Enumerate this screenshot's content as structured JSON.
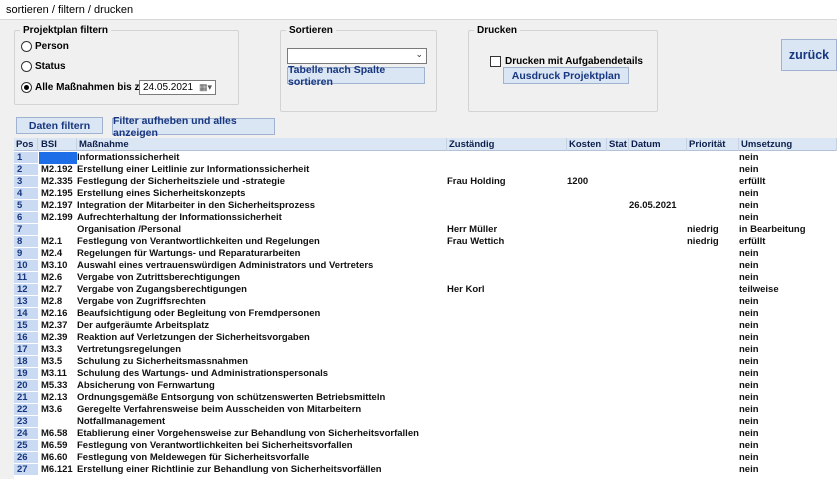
{
  "window": {
    "title": "sortieren / filtern / drucken"
  },
  "filter_group": {
    "legend": "Projektplan filtern",
    "options": [
      {
        "label": "Person",
        "selected": false
      },
      {
        "label": "Status",
        "selected": false
      },
      {
        "label": "Alle Maßnahmen bis zum",
        "selected": true
      }
    ],
    "date_value": "24.05.2021"
  },
  "sort_group": {
    "legend": "Sortieren",
    "combo_value": "",
    "sort_button": "Tabelle nach Spalte sortieren"
  },
  "print_group": {
    "legend": "Drucken",
    "checkbox_label": "Drucken mit Aufgabendetails",
    "checkbox_checked": false,
    "print_button": "Ausdruck Projektplan"
  },
  "back_button": "zurück",
  "filter_button": "Daten filtern",
  "reset_button": "Filter aufheben und alles anzeigen",
  "table": {
    "columns": {
      "pos": "Pos",
      "bsi": "BSI",
      "massnahme": "Maßnahme",
      "zustaendig": "Zuständig",
      "kosten": "Kosten",
      "stat": "Stat",
      "datum": "Datum",
      "prioritaet": "Priorität",
      "umsetzung": "Umsetzung"
    },
    "rows": [
      {
        "pos": "1",
        "bsi": "",
        "massnahme": "Informationssicherheit",
        "zustaendig": "",
        "kosten": "",
        "stat": "",
        "datum": "",
        "prioritaet": "",
        "umsetzung": "nein"
      },
      {
        "pos": "2",
        "bsi": "M2.192",
        "massnahme": "Erstellung einer Leitlinie zur Informationssicherheit",
        "zustaendig": "",
        "kosten": "",
        "stat": "",
        "datum": "",
        "prioritaet": "",
        "umsetzung": "nein"
      },
      {
        "pos": "3",
        "bsi": "M2.335",
        "massnahme": "Festlegung der Sicherheitsziele und -strategie",
        "zustaendig": "Frau Holding",
        "kosten": "1200",
        "stat": "",
        "datum": "",
        "prioritaet": "",
        "umsetzung": "erfüllt"
      },
      {
        "pos": "4",
        "bsi": "M2.195",
        "massnahme": "Erstellung eines Sicherheitskonzepts",
        "zustaendig": "",
        "kosten": "",
        "stat": "",
        "datum": "",
        "prioritaet": "",
        "umsetzung": "nein"
      },
      {
        "pos": "5",
        "bsi": "M2.197",
        "massnahme": "Integration der Mitarbeiter in den Sicherheitsprozess",
        "zustaendig": "",
        "kosten": "",
        "stat": "",
        "datum": "26.05.2021",
        "prioritaet": "",
        "umsetzung": "nein"
      },
      {
        "pos": "6",
        "bsi": "M2.199",
        "massnahme": "Aufrechterhaltung der Informationssicherheit",
        "zustaendig": "",
        "kosten": "",
        "stat": "",
        "datum": "",
        "prioritaet": "",
        "umsetzung": "nein"
      },
      {
        "pos": "7",
        "bsi": "",
        "massnahme": "Organisation /Personal",
        "zustaendig": "Herr Müller",
        "kosten": "",
        "stat": "",
        "datum": "",
        "prioritaet": "niedrig",
        "umsetzung": "in Bearbeitung"
      },
      {
        "pos": "8",
        "bsi": "M2.1",
        "massnahme": "Festlegung von Verantwortlichkeiten und Regelungen",
        "zustaendig": "Frau Wettich",
        "kosten": "",
        "stat": "",
        "datum": "",
        "prioritaet": "niedrig",
        "umsetzung": "erfüllt"
      },
      {
        "pos": "9",
        "bsi": "M2.4",
        "massnahme": "Regelungen für Wartungs- und Reparaturarbeiten",
        "zustaendig": "",
        "kosten": "",
        "stat": "",
        "datum": "",
        "prioritaet": "",
        "umsetzung": "nein"
      },
      {
        "pos": "10",
        "bsi": "M3.10",
        "massnahme": "Auswahl eines vertrauenswürdigen Administrators und Vertreters",
        "zustaendig": "",
        "kosten": "",
        "stat": "",
        "datum": "",
        "prioritaet": "",
        "umsetzung": "nein"
      },
      {
        "pos": "11",
        "bsi": "M2.6",
        "massnahme": "Vergabe von Zutrittsberechtigungen",
        "zustaendig": "",
        "kosten": "",
        "stat": "",
        "datum": "",
        "prioritaet": "",
        "umsetzung": "nein"
      },
      {
        "pos": "12",
        "bsi": "M2.7",
        "massnahme": "Vergabe von Zugangsberechtigungen",
        "zustaendig": "Her Korl",
        "kosten": "",
        "stat": "",
        "datum": "",
        "prioritaet": "",
        "umsetzung": "teilweise"
      },
      {
        "pos": "13",
        "bsi": "M2.8",
        "massnahme": "Vergabe von Zugriffsrechten",
        "zustaendig": "",
        "kosten": "",
        "stat": "",
        "datum": "",
        "prioritaet": "",
        "umsetzung": "nein"
      },
      {
        "pos": "14",
        "bsi": "M2.16",
        "massnahme": "Beaufsichtigung oder Begleitung von Fremdpersonen",
        "zustaendig": "",
        "kosten": "",
        "stat": "",
        "datum": "",
        "prioritaet": "",
        "umsetzung": "nein"
      },
      {
        "pos": "15",
        "bsi": "M2.37",
        "massnahme": "Der aufgeräumte Arbeitsplatz",
        "zustaendig": "",
        "kosten": "",
        "stat": "",
        "datum": "",
        "prioritaet": "",
        "umsetzung": "nein"
      },
      {
        "pos": "16",
        "bsi": "M2.39",
        "massnahme": "Reaktion auf Verletzungen der Sicherheitsvorgaben",
        "zustaendig": "",
        "kosten": "",
        "stat": "",
        "datum": "",
        "prioritaet": "",
        "umsetzung": "nein"
      },
      {
        "pos": "17",
        "bsi": "M3.3",
        "massnahme": "Vertretungsregelungen",
        "zustaendig": "",
        "kosten": "",
        "stat": "",
        "datum": "",
        "prioritaet": "",
        "umsetzung": "nein"
      },
      {
        "pos": "18",
        "bsi": "M3.5",
        "massnahme": "Schulung zu Sicherheitsmassnahmen",
        "zustaendig": "",
        "kosten": "",
        "stat": "",
        "datum": "",
        "prioritaet": "",
        "umsetzung": "nein"
      },
      {
        "pos": "19",
        "bsi": "M3.11",
        "massnahme": "Schulung des Wartungs- und Administrationspersonals",
        "zustaendig": "",
        "kosten": "",
        "stat": "",
        "datum": "",
        "prioritaet": "",
        "umsetzung": "nein"
      },
      {
        "pos": "20",
        "bsi": "M5.33",
        "massnahme": "Absicherung von Fernwartung",
        "zustaendig": "",
        "kosten": "",
        "stat": "",
        "datum": "",
        "prioritaet": "",
        "umsetzung": "nein"
      },
      {
        "pos": "21",
        "bsi": "M2.13",
        "massnahme": "Ordnungsgemäße Entsorgung von schützenswerten Betriebsmitteln",
        "zustaendig": "",
        "kosten": "",
        "stat": "",
        "datum": "",
        "prioritaet": "",
        "umsetzung": "nein"
      },
      {
        "pos": "22",
        "bsi": "M3.6",
        "massnahme": "Geregelte Verfahrensweise beim Ausscheiden von Mitarbeitern",
        "zustaendig": "",
        "kosten": "",
        "stat": "",
        "datum": "",
        "prioritaet": "",
        "umsetzung": "nein"
      },
      {
        "pos": "23",
        "bsi": "",
        "massnahme": "Notfallmanagement",
        "zustaendig": "",
        "kosten": "",
        "stat": "",
        "datum": "",
        "prioritaet": "",
        "umsetzung": "nein"
      },
      {
        "pos": "24",
        "bsi": "M6.58",
        "massnahme": "Etablierung einer Vorgehensweise zur Behandlung von Sicherheitsvorfallen",
        "zustaendig": "",
        "kosten": "",
        "stat": "",
        "datum": "",
        "prioritaet": "",
        "umsetzung": "nein"
      },
      {
        "pos": "25",
        "bsi": "M6.59",
        "massnahme": "Festlegung von Verantwortlichkeiten bei Sicherheitsvorfallen",
        "zustaendig": "",
        "kosten": "",
        "stat": "",
        "datum": "",
        "prioritaet": "",
        "umsetzung": "nein"
      },
      {
        "pos": "26",
        "bsi": "M6.60",
        "massnahme": "Festlegung von Meldewegen für Sicherheitsvorfalle",
        "zustaendig": "",
        "kosten": "",
        "stat": "",
        "datum": "",
        "prioritaet": "",
        "umsetzung": "nein"
      },
      {
        "pos": "27",
        "bsi": "M6.121",
        "massnahme": "Erstellung einer Richtlinie zur Behandlung von Sicherheitsvorfällen",
        "zustaendig": "",
        "kosten": "",
        "stat": "",
        "datum": "",
        "prioritaet": "",
        "umsetzung": "nein"
      }
    ]
  },
  "colors": {
    "background": "#f0f0f0",
    "header_bg": "#dbe6f4",
    "pos_cell_bg": "#c9daf2",
    "selection": "#1e6ee8",
    "button_text": "#17367f"
  }
}
